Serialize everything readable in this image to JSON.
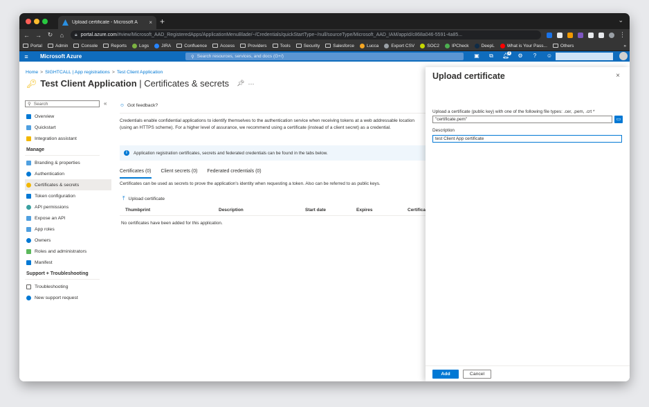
{
  "browser": {
    "tab_title": "Upload certificate - Microsoft A",
    "tab_close": "×",
    "new_tab": "+",
    "url_host": "portal.azure.com",
    "url_path": "/#view/Microsoft_AAD_RegisteredApps/ApplicationMenuBlade/~/Credentials/quickStartType~/null/sourceType/Microsoft_AAD_IAM/appId/c868a046-5591-4a85...",
    "bookmarks": [
      "Portal",
      "Admin",
      "Console",
      "Reports",
      "Logs",
      "JIRA",
      "Confluence",
      "Access",
      "Providers",
      "Tools",
      "Security",
      "Salesforce",
      "Lucca",
      "Export CSV",
      "SOC2",
      "IPCheck",
      "DeepL",
      "What is Your Pass...",
      "Others"
    ],
    "bookmarks_more": "»"
  },
  "azure": {
    "brand": "Microsoft Azure",
    "search_placeholder": "Search resources, services, and docs (G+/)",
    "notification_count": "9"
  },
  "breadcrumb": {
    "items": [
      "Home",
      "SIGHTCALL | App registrations",
      "Test Client Application"
    ],
    "separator": ">"
  },
  "page": {
    "title_bold": "Test Client Application",
    "title_rest": " | Certificates & secrets",
    "more": "···"
  },
  "sidebar": {
    "search_placeholder": "Search",
    "collapse": "«",
    "top_items": [
      {
        "label": "Overview",
        "color": "#0078d4"
      },
      {
        "label": "Quickstart",
        "color": "#50a0e0"
      },
      {
        "label": "Integration assistant",
        "color": "#f2b700"
      }
    ],
    "manage_heading": "Manage",
    "manage_items": [
      {
        "label": "Branding & properties",
        "color": "#50a0e0"
      },
      {
        "label": "Authentication",
        "color": "#0078d4"
      },
      {
        "label": "Certificates & secrets",
        "color": "#f2b700"
      },
      {
        "label": "Token configuration",
        "color": "#0078d4"
      },
      {
        "label": "API permissions",
        "color": "#3aa0a0"
      },
      {
        "label": "Expose an API",
        "color": "#50a0e0"
      },
      {
        "label": "App roles",
        "color": "#50a0e0"
      },
      {
        "label": "Owners",
        "color": "#0078d4"
      },
      {
        "label": "Roles and administrators",
        "color": "#5cb85c"
      },
      {
        "label": "Manifest",
        "color": "#0078d4"
      }
    ],
    "support_heading": "Support + Troubleshooting",
    "support_items": [
      {
        "label": "Troubleshooting",
        "color": "#605e5c"
      },
      {
        "label": "New support request",
        "color": "#0078d4"
      }
    ]
  },
  "main": {
    "feedback": "Got feedback?",
    "intro": "Credentials enable confidential applications to identify themselves to the authentication service when receiving tokens at a web addressable location (using an HTTPS scheme). For a higher level of assurance, we recommend using a certificate (instead of a client secret) as a credential.",
    "info_banner": "Application registration certificates, secrets and federated credentials can be found in the tabs below.",
    "tabs": [
      "Certificates (0)",
      "Client secrets (0)",
      "Federated credentials (0)"
    ],
    "tab_description": "Certificates can be used as secrets to prove the application's identity when requesting a token. Also can be referred to as public keys.",
    "upload_label": "Upload certificate",
    "columns": [
      "Thumbprint",
      "Description",
      "Start date",
      "Expires",
      "Certificate ID"
    ],
    "empty_text": "No certificates have been added for this application."
  },
  "panel": {
    "title": "Upload certificate",
    "close": "×",
    "file_label": "Upload a certificate (public key) with one of the following file types: .cer, .pem, .crt *",
    "file_value": "\"certificate.pem\"",
    "description_label": "Description",
    "description_value": "test Client App certificate",
    "add_label": "Add",
    "cancel_label": "Cancel"
  }
}
